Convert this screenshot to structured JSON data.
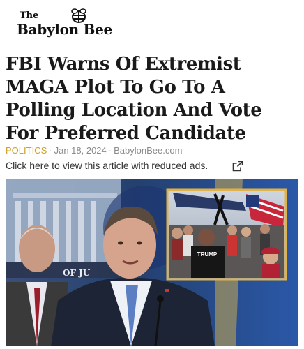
{
  "brand": {
    "the": "The",
    "name": "Babylon Bee"
  },
  "article": {
    "headline": "FBI Warns Of Extremist MAGA Plot To Go To A Polling Location And Vote For Preferred Candidate",
    "category": "POLITICS",
    "date": "Jan 18, 2024",
    "source": "BabylonBee.com",
    "separator": "·"
  },
  "ads": {
    "link_text": "Click here",
    "rest_text": " to view this article with reduced ads."
  },
  "photo": {
    "building_text": "OF JU",
    "hat_text": "TRUMP"
  },
  "colors": {
    "accent": "#d3a11c",
    "inset_border": "#e0b24a",
    "backdrop": "#2d4d8a"
  },
  "icons": {
    "logo": "bee-icon",
    "external": "external-link-icon"
  }
}
